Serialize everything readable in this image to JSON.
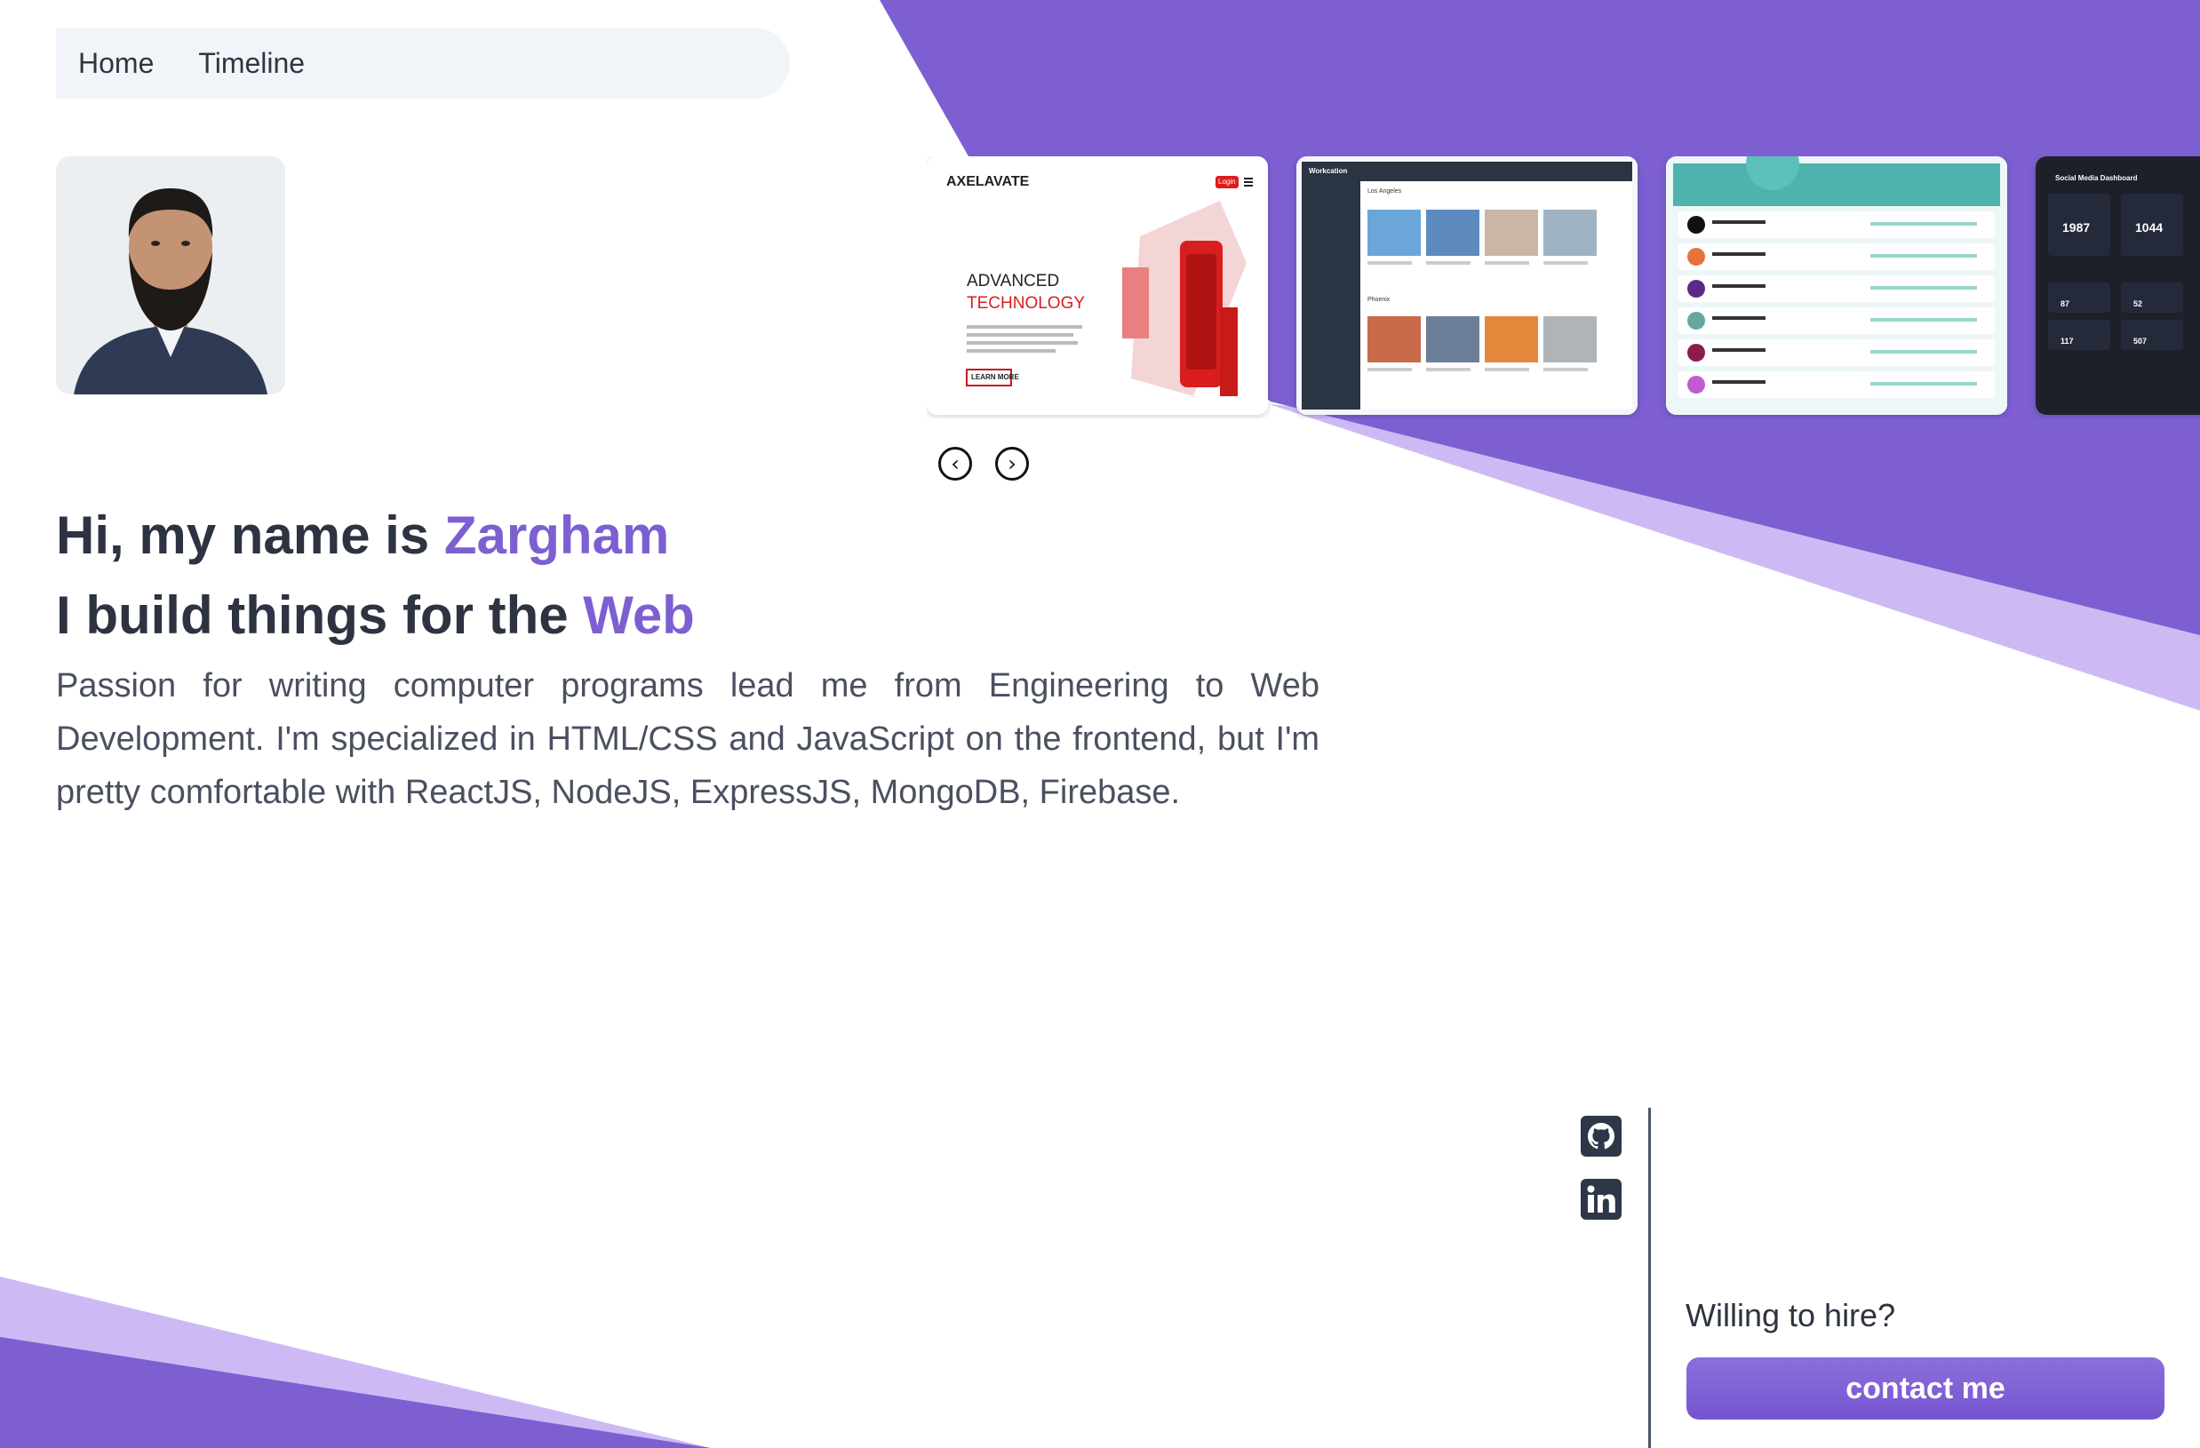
{
  "nav": {
    "items": [
      "Home",
      "Timeline"
    ]
  },
  "profile": {
    "photo_alt": "profile photo"
  },
  "hero": {
    "greeting_prefix": "Hi, my name is ",
    "name": "Zargham",
    "build_prefix": "I build things for the ",
    "build_accent": "Web",
    "bio": "Passion for writing computer programs lead me from Engineering to Web Development. I'm specialized in HTML/CSS and JavaScript on the frontend, but I'm pretty comfortable with ReactJS, NodeJS, ExpressJS, MongoDB, Firebase."
  },
  "carousel": {
    "slides": [
      {
        "logo": "AXELAVATE",
        "login": "Login",
        "headline1": "ADVANCED",
        "headline2": "TECHNOLOGY",
        "cta": "LEARN MORE"
      },
      {
        "app_title": "Workcation",
        "section1": "Los Angeles",
        "section2": "Phoenix"
      },
      {
        "listing_count": 6
      },
      {
        "title": "Social Media Dashboard",
        "followers": [
          "1987",
          "1044"
        ],
        "stats": [
          "87",
          "52",
          "117",
          "507"
        ]
      }
    ],
    "prev_icon": "chevron-left-icon",
    "next_icon": "chevron-right-icon"
  },
  "social": {
    "icons": [
      "github-icon",
      "linkedin-icon"
    ]
  },
  "hire": {
    "question": "Willing to hire?",
    "button_label": "contact me"
  },
  "colors": {
    "accent": "#7d5fd1",
    "purple_dark": "#7d5fd1",
    "purple_light": "#cbb9f3",
    "text": "#2d3340"
  }
}
